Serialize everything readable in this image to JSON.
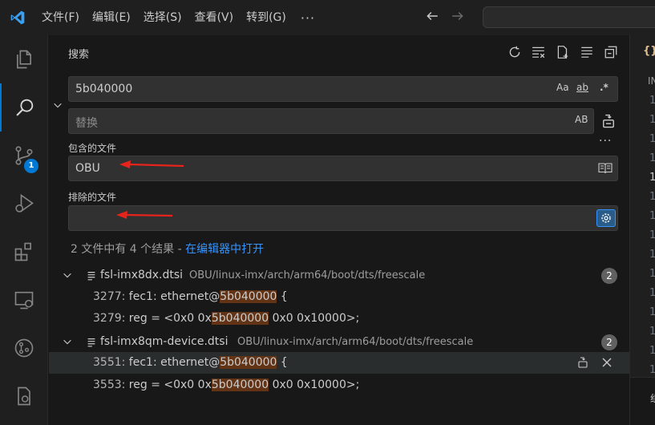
{
  "menu": {
    "items": [
      "文件(F)",
      "编辑(E)",
      "选择(S)",
      "查看(V)",
      "转到(G)"
    ],
    "more": "···"
  },
  "activity": {
    "badge": "1"
  },
  "search": {
    "title": "搜索",
    "query": "5b040000",
    "match_case": "Aa",
    "whole_word": "ab",
    "regex": ".*",
    "replace_placeholder": "替换",
    "preserve_case": "AB",
    "more_options": "···",
    "include_label": "包含的文件",
    "include_value": "OBU",
    "exclude_label": "排除的文件",
    "exclude_value": "",
    "summary_prefix": "2 文件中有 4 个结果 - ",
    "summary_link": "在编辑器中打开"
  },
  "results": [
    {
      "file": "fsl-imx8dx.dtsi",
      "path": "OBU/linux-imx/arch/arm64/boot/dts/freescale",
      "count": "2",
      "matches": [
        {
          "line": "3277:",
          "before": " fec1: ethernet@",
          "match": "5b040000",
          "after": " {"
        },
        {
          "line": "3279:",
          "before": " reg = <0x0 0x",
          "match": "5b040000",
          "after": " 0x0 0x10000>;"
        }
      ]
    },
    {
      "file": "fsl-imx8qm-device.dtsi",
      "path": "OBU/linux-imx/arch/arm64/boot/dts/freescale",
      "count": "2",
      "matches": [
        {
          "line": "3551:",
          "before": " fec1: ethernet@",
          "match": "5b040000",
          "after": " {"
        },
        {
          "line": "3553:",
          "before": " reg = <0x0 0x",
          "match": "5b040000",
          "after": " 0x0 0x10000>;"
        }
      ]
    }
  ],
  "editor": {
    "tab_icon": "{}",
    "breadcrumb": "IN",
    "line_numbers": [
      "1",
      "1",
      "1",
      "1",
      "1",
      "1",
      "1",
      "1",
      "1",
      "1",
      "1",
      "1",
      "1",
      "1",
      "1",
      "1"
    ],
    "bottom_text": "组"
  },
  "colors": {
    "accent": "#0078d4",
    "match_highlight": "#623315",
    "link": "#3794ff",
    "annotation_arrow": "#e8231c"
  },
  "icons": [
    "vscode-logo-icon",
    "back-arrow-icon",
    "forward-arrow-icon",
    "explorer-icon",
    "search-icon",
    "source-control-icon",
    "run-debug-icon",
    "extensions-icon",
    "remote-explorer-icon",
    "git-lens-icon",
    "settings-gear-icon",
    "refresh-icon",
    "clear-results-icon",
    "new-search-editor-icon",
    "view-as-tree-icon",
    "collapse-all-icon",
    "replace-all-icon",
    "book-icon",
    "exclude-settings-icon",
    "file-icon",
    "replace-icon",
    "dismiss-icon"
  ]
}
